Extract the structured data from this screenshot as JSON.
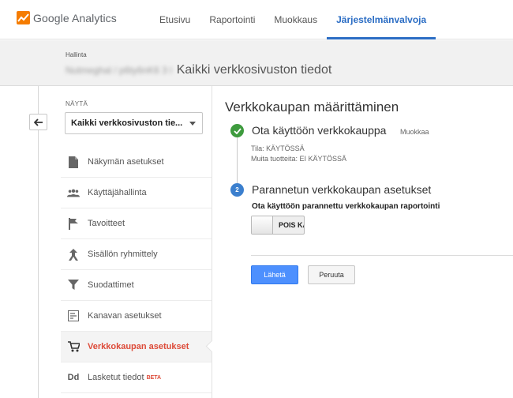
{
  "app": {
    "logo_text": "Google Analytics",
    "nav": [
      {
        "label": "Etusivu"
      },
      {
        "label": "Raportointi"
      },
      {
        "label": "Muokkaus"
      },
      {
        "label": "Järjestelmänvalvoja",
        "active": true
      }
    ]
  },
  "header": {
    "admin_label": "Hallinta",
    "breadcrumb_blurred": "Nutmeghal / p6ty6nK6 3 l",
    "breadcrumb_current": "Kaikki verkkosivuston tiedot"
  },
  "sidebar": {
    "view_label": "NÄYTÄ",
    "selected_view": "Kaikki verkkosivuston tie...",
    "items": [
      {
        "label": "Näkymän asetukset",
        "icon": "document-icon"
      },
      {
        "label": "Käyttäjähallinta",
        "icon": "users-icon"
      },
      {
        "label": "Tavoitteet",
        "icon": "flag-icon"
      },
      {
        "label": "Sisällön ryhmittely",
        "icon": "grouping-icon"
      },
      {
        "label": "Suodattimet",
        "icon": "filter-icon"
      },
      {
        "label": "Kanavan asetukset",
        "icon": "channel-settings-icon"
      },
      {
        "label": "Verkkokaupan asetukset",
        "icon": "cart-icon",
        "active": true
      },
      {
        "label": "Lasketut tiedot",
        "icon": "calculated-icon",
        "icon_text": "Dd",
        "badge": "BETA"
      }
    ]
  },
  "main": {
    "title": "Verkkokaupan määrittäminen",
    "step1": {
      "title": "Ota käyttöön verkkokauppa",
      "edit": "Muokkaa",
      "status": "Tila: KÄYTÖSSÄ",
      "related": "Muita tuotteita: EI KÄYTÖSSÄ"
    },
    "step2": {
      "number": "2",
      "title": "Parannetun verkkokaupan asetukset",
      "toggle_label": "Ota käyttöön parannettu verkkokaupan raportointi",
      "toggle_text": "POIS KÄ"
    },
    "submit_label": "Lähetä",
    "cancel_label": "Peruuta"
  },
  "colors": {
    "accent": "#2b6dc4",
    "active_menu": "#dd4b39",
    "success": "#3e9b3e",
    "primary_button": "#4d90fe"
  }
}
